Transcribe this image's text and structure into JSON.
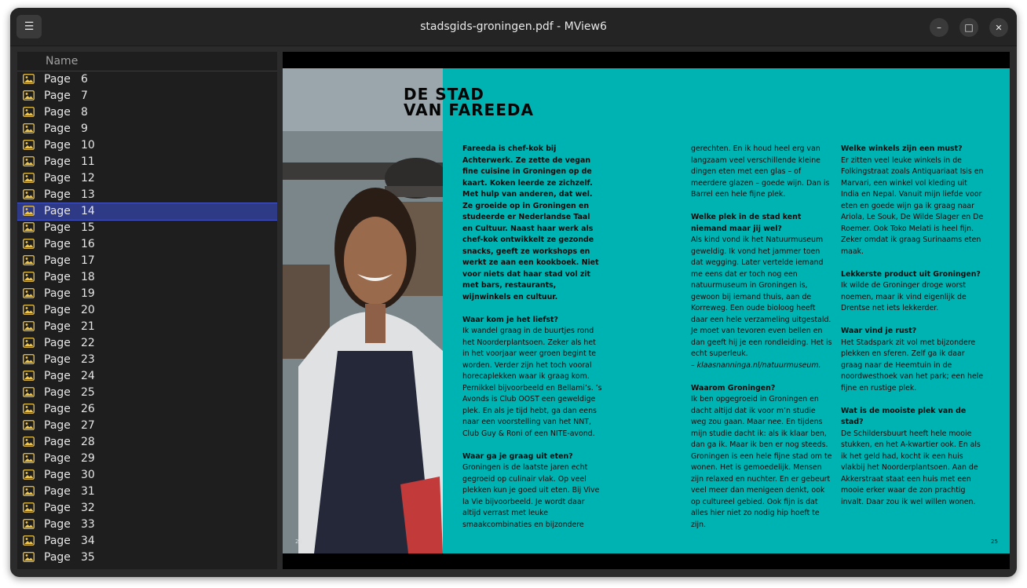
{
  "window": {
    "title": "stadsgids-groningen.pdf - MView6",
    "menu_icon": "☰",
    "minimize_icon": "–",
    "maximize_icon": "□",
    "close_icon": "✕"
  },
  "sidebar": {
    "column_header": "Name",
    "items": [
      {
        "label": "Page",
        "num": "6"
      },
      {
        "label": "Page",
        "num": "7"
      },
      {
        "label": "Page",
        "num": "8"
      },
      {
        "label": "Page",
        "num": "9"
      },
      {
        "label": "Page",
        "num": "10"
      },
      {
        "label": "Page",
        "num": "11"
      },
      {
        "label": "Page",
        "num": "12"
      },
      {
        "label": "Page",
        "num": "13"
      },
      {
        "label": "Page",
        "num": "14",
        "selected": true
      },
      {
        "label": "Page",
        "num": "15"
      },
      {
        "label": "Page",
        "num": "16"
      },
      {
        "label": "Page",
        "num": "17"
      },
      {
        "label": "Page",
        "num": "18"
      },
      {
        "label": "Page",
        "num": "19"
      },
      {
        "label": "Page",
        "num": "20"
      },
      {
        "label": "Page",
        "num": "21"
      },
      {
        "label": "Page",
        "num": "22"
      },
      {
        "label": "Page",
        "num": "23"
      },
      {
        "label": "Page",
        "num": "24"
      },
      {
        "label": "Page",
        "num": "25"
      },
      {
        "label": "Page",
        "num": "26"
      },
      {
        "label": "Page",
        "num": "27"
      },
      {
        "label": "Page",
        "num": "28"
      },
      {
        "label": "Page",
        "num": "29"
      },
      {
        "label": "Page",
        "num": "30"
      },
      {
        "label": "Page",
        "num": "31"
      },
      {
        "label": "Page",
        "num": "32"
      },
      {
        "label": "Page",
        "num": "33"
      },
      {
        "label": "Page",
        "num": "34"
      },
      {
        "label": "Page",
        "num": "35"
      }
    ],
    "item_icon": "image-icon",
    "selected_color": "#2f3a86"
  },
  "document": {
    "heading_line1": "DE STAD",
    "heading_line2": "VAN FAREEDA",
    "intro": "Fareeda is chef-kok bij Achterwerk. Ze zette de vegan fine cuisine in Groningen op de kaart. Koken leerde ze zichzelf. Met hulp van anderen, dat wel. Ze groeide op in Groningen en studeerde er Nederlandse Taal en Cultuur. Naast haar werk als chef-kok ontwikkelt ze gezonde snacks, geeft ze workshops en werkt ze aan een kookboek. Niet voor niets dat haar stad vol zit met bars, restaurants, wijnwinkels en cultuur.",
    "q1": "Waar kom je het liefst?",
    "a1": "Ik wandel graag in de buurtjes rond het Noorderplantsoen. Zeker als het in het voorjaar weer groen begint te worden. Verder zijn het toch vooral horecaplekken waar ik graag kom. Pernikkel bijvoorbeeld en Bellami’s. ’s Avonds is Club OOST een geweldige plek. En als je tijd hebt, ga dan eens naar een voorstelling van het NNT, Club Guy & Roni of een NITE-avond.",
    "q2": "Waar ga je graag uit eten?",
    "a2": "Groningen is de laatste jaren echt gegroeid op culinair vlak. Op veel plekken kun je goed uit eten. Bij Vive la Vie bijvoorbeeld. Je wordt daar altijd verrast met leuke smaakcombinaties en bijzondere",
    "a2_cont": "gerechten. En ik houd heel erg van langzaam veel verschillende kleine dingen eten met een glas – of meerdere glazen – goede wijn. Dan is Barrel een hele fijne plek.",
    "q3": "Welke plek in de stad kent niemand maar jij wel?",
    "a3": "Als kind vond ik het Natuurmuseum geweldig. Ik vond het jammer toen dat wegging. Later vertelde iemand me eens dat er toch nog een natuurmuseum in Groningen is, gewoon bij iemand thuis, aan de Korreweg. Een oude bioloog heeft daar een hele verzameling uitgestald. Je moet van tevoren even bellen en dan geeft hij je een rondleiding. Het is echt superleuk.",
    "a3_link": "– klaasnanninga.nl/natuurmuseum.",
    "q4": "Waarom Groningen?",
    "a4": "Ik ben opgegroeid in Groningen en dacht altijd dat ik voor m’n studie weg zou gaan. Maar nee. En tijdens mijn studie dacht ik: als ik klaar ben, dan ga ik. Maar ik ben er nog steeds. Groningen is een hele fijne stad om te wonen. Het is gemoedelijk. Mensen zijn relaxed en nuchter. En er gebeurt veel meer dan menigeen denkt, ook op cultureel gebied. Ook fijn is dat alles hier niet zo nodig hip hoeft te zijn.",
    "q5": "Welke winkels zijn een must?",
    "a5": "Er zitten veel leuke winkels in de Folkingstraat zoals Antiquariaat Isis en Marvari, een winkel vol kleding uit India en Nepal. Vanuit mijn liefde voor eten en goede wijn ga ik graag naar Ariola, Le Souk, De Wilde Slager en De Roemer. Ook Toko Melati is heel fijn. Zeker omdat ik graag Surinaams eten maak.",
    "q6": "Lekkerste product uit Groningen?",
    "a6": "Ik wilde de Groninger droge worst noemen, maar ik vind eigenlijk de Drentse net iets lekkerder.",
    "q7": "Waar vind je rust?",
    "a7": "Het Stadspark zit vol met bijzondere plekken en sferen. Zelf ga ik daar graag naar de Heemtuin in de noordwesthoek van het park; een hele fijne en rustige plek.",
    "q8": "Wat is de mooiste plek van de stad?",
    "a8": "De Schildersbuurt heeft hele mooie stukken, en het A-kwartier ook. En als ik het geld had, kocht ik een huis vlakbij het Noorderplantsoen. Aan de Akkerstraat staat een huis met een mooie erker waar de zon prachtig invalt. Daar zou ik wel willen wonen.",
    "page_left": "24",
    "page_right": "25",
    "accent": "#00b3b3"
  }
}
